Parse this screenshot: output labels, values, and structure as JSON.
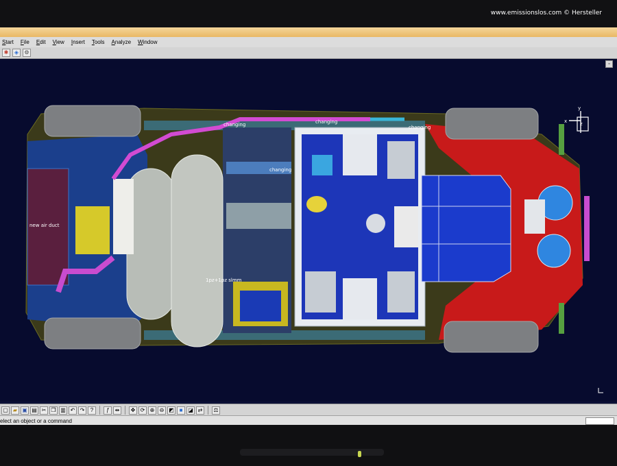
{
  "watermark": "www.emissionslos.com © Hersteller",
  "menu": {
    "items": [
      "Start",
      "File",
      "Edit",
      "View",
      "Insert",
      "Tools",
      "Analyze",
      "Window"
    ]
  },
  "toolbar_top": {
    "icons": [
      "start-icon",
      "model-icon",
      "settings-icon"
    ]
  },
  "viewport": {
    "labels": {
      "changing_1": "changing",
      "changing_2": "changing",
      "changing_3": "changing",
      "changing_4": "changing",
      "air_duct": "new air duct",
      "dimension": "1pz+1pz slmm"
    },
    "compass": {
      "x": "x",
      "y": "y",
      "z": "z"
    }
  },
  "toolbar_bottom": {
    "icons": [
      "new-icon",
      "open-icon",
      "save-icon",
      "print-icon",
      "cut-icon",
      "copy-icon",
      "paste-icon",
      "undo-icon",
      "redo-icon",
      "help-icon",
      "formula-icon",
      "measure-icon",
      "pan-icon",
      "rotate-icon",
      "zoom-in-icon",
      "zoom-out-icon",
      "normal-view-icon",
      "render-icon",
      "hide-icon",
      "swap-icon",
      "analysis-icon"
    ]
  },
  "statusbar": {
    "message": "elect an object or a command"
  }
}
